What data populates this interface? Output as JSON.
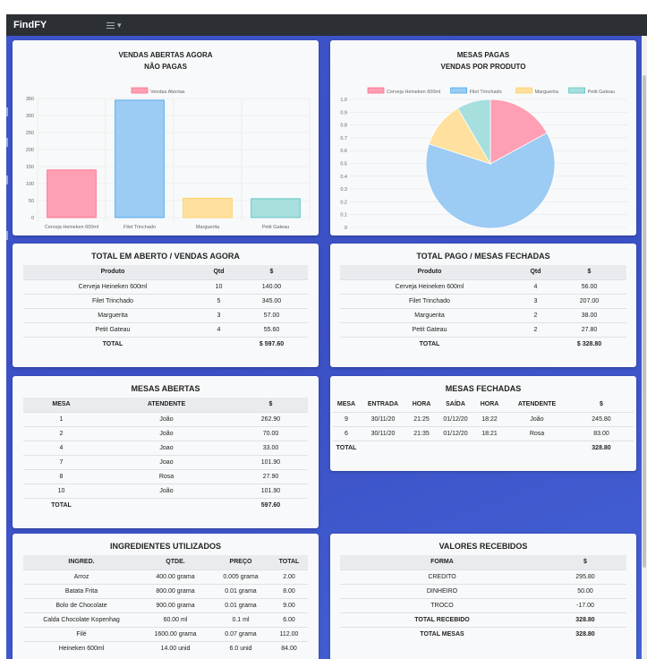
{
  "app": {
    "brand": "FindFY",
    "menu_caret": "▾"
  },
  "colors": {
    "pink": "#ff9fb3",
    "pink_stroke": "#ff6384",
    "blue": "#9ccbf3",
    "blue_stroke": "#36a2eb",
    "yellow": "#ffe09e",
    "yellow_stroke": "#ffcd56",
    "teal": "#a6dfdd",
    "teal_stroke": "#4bc0c0"
  },
  "bar_card": {
    "title1": "VENDAS ABERTAS AGORA",
    "title2": "NÃO PAGAS"
  },
  "pie_card": {
    "title1": "MESAS PAGAS",
    "title2": "VENDAS POR PRODUTO"
  },
  "chart_data": [
    {
      "type": "bar",
      "categories": [
        "Cerveja Heineken 600ml",
        "Filet Trinchado",
        "Marguerita",
        "Petit Gateau"
      ],
      "series": [
        {
          "name": "Vendas Abertas",
          "values": [
            140,
            345,
            57,
            55.6
          ]
        }
      ],
      "ylim": [
        0,
        350
      ],
      "yticks": [
        0,
        50,
        100,
        150,
        200,
        250,
        300,
        350
      ],
      "legend": "top",
      "grid": true
    },
    {
      "type": "pie",
      "labels": [
        "Cerveja Heineken 600ml",
        "Filet Trinchado",
        "Marguerita",
        "Petit Gateau"
      ],
      "values": [
        56,
        207,
        38,
        27.8
      ],
      "yticks": [
        "0",
        "0.1",
        "0.2",
        "0.3",
        "0.4",
        "0.5",
        "0.6",
        "0.7",
        "0.8",
        "0.9",
        "1.0"
      ],
      "legend": "top",
      "grid": true
    }
  ],
  "open_total": {
    "title": "TOTAL EM ABERTO / VENDAS AGORA",
    "headers": [
      "Produto",
      "Qtd",
      "$"
    ],
    "rows": [
      [
        "Cerveja Heineken 600ml",
        "10",
        "140.00"
      ],
      [
        "Filet Trinchado",
        "5",
        "345.00"
      ],
      [
        "Marguerita",
        "3",
        "57.00"
      ],
      [
        "Petit Gateau",
        "4",
        "55.60"
      ]
    ],
    "total_label": "TOTAL",
    "total_value": "$ 597.60"
  },
  "paid_total": {
    "title": "TOTAL PAGO / MESAS FECHADAS",
    "headers": [
      "Produto",
      "Qtd",
      "$"
    ],
    "rows": [
      [
        "Cerveja Heineken 600ml",
        "4",
        "56.00"
      ],
      [
        "Filet Trinchado",
        "3",
        "207.00"
      ],
      [
        "Marguerita",
        "2",
        "38.00"
      ],
      [
        "Petit Gateau",
        "2",
        "27.80"
      ]
    ],
    "total_label": "TOTAL",
    "total_value": "$ 328.80"
  },
  "open_tables": {
    "title": "MESAS ABERTAS",
    "headers": [
      "MESA",
      "ATENDENTE",
      "$"
    ],
    "rows": [
      [
        "1",
        "João",
        "262.90"
      ],
      [
        "2",
        "João",
        "70.00"
      ],
      [
        "4",
        "Joao",
        "33.00"
      ],
      [
        "7",
        "Joao",
        "101.90"
      ],
      [
        "8",
        "Rosa",
        "27.90"
      ],
      [
        "10",
        "João",
        "101.90"
      ]
    ],
    "total_label": "TOTAL",
    "total_value": "597.60"
  },
  "closed_tables": {
    "title": "MESAS FECHADAS",
    "headers": [
      "MESA",
      "ENTRADA",
      "HORA",
      "SAÍDA",
      "HORA",
      "ATENDENTE",
      "$"
    ],
    "rows": [
      [
        "9",
        "30/11/20",
        "21:25",
        "01/12/20",
        "18:22",
        "João",
        "245.80"
      ],
      [
        "6",
        "30/11/20",
        "21:35",
        "01/12/20",
        "18:21",
        "Rosa",
        "83.00"
      ]
    ],
    "total_label": "TOTAL",
    "total_value": "328.80"
  },
  "ingredients": {
    "title": "INGREDIENTES UTILIZADOS",
    "headers": [
      "INGRED.",
      "QTDE.",
      "PREÇO",
      "TOTAL"
    ],
    "rows": [
      [
        "Arroz",
        "400.00 grama",
        "0.005 grama",
        "2.00"
      ],
      [
        "Batata Frita",
        "800.00 grama",
        "0.01 grama",
        "8.00"
      ],
      [
        "Bolo de Chocolate",
        "900.00 grama",
        "0.01 grama",
        "9.00"
      ],
      [
        "Calda Chocolate Kopenhag",
        "60.00 ml",
        "0.1 ml",
        "6.00"
      ],
      [
        "Filé",
        "1600.00 grama",
        "0.07 grama",
        "112.00"
      ],
      [
        "Heineken 600ml",
        "14.00 unid",
        "6.0 unid",
        "84.00"
      ]
    ]
  },
  "received": {
    "title": "VALORES RECEBIDOS",
    "headers": [
      "FORMA",
      "$"
    ],
    "rows": [
      [
        "CREDITO",
        "295.80"
      ],
      [
        "DINHEIRO",
        "50.00"
      ],
      [
        "TROCO",
        "-17.00"
      ]
    ],
    "bold_rows": [
      [
        "TOTAL RECEBIDO",
        "328.80"
      ],
      [
        "TOTAL MESAS",
        "328.80"
      ]
    ]
  }
}
